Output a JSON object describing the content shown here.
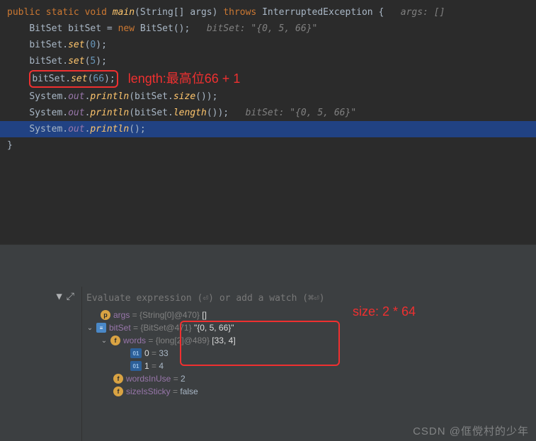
{
  "code": {
    "l1": {
      "public": "public",
      "static": "static",
      "void": "void",
      "main": "main",
      "string": "String",
      "args": "args",
      "throws": "throws",
      "exc": "InterruptedException",
      "comment": "args: []"
    },
    "l2": {
      "type": "BitSet",
      "var": "bitSet",
      "new": "new",
      "ctor": "BitSet",
      "comment": "bitSet: \"{0, 5, 66}\""
    },
    "l3": {
      "obj": "bitSet",
      "method": "set",
      "arg": "0"
    },
    "l4": {
      "obj": "bitSet",
      "method": "set",
      "arg": "5"
    },
    "l5": {
      "obj": "bitSet",
      "method": "set",
      "arg": "66",
      "anno": "length:最高位66 + 1"
    },
    "l6": {
      "sys": "System",
      "out": "out",
      "println": "println",
      "arg": "bitSet",
      "method": "size"
    },
    "l7": {
      "sys": "System",
      "out": "out",
      "println": "println",
      "arg": "bitSet",
      "method": "length",
      "comment": "bitSet: \"{0, 5, 66}\""
    },
    "l8": {
      "sys": "System",
      "out": "out",
      "println": "println"
    }
  },
  "debug": {
    "placeholder": "Evaluate expression (⏎) or add a watch (⌘⏎)",
    "size_anno": "size: 2 * 64",
    "rows": {
      "args": {
        "name": "args",
        "eq": " = ",
        "ref": "{String[0]@470} ",
        "val": "[]"
      },
      "bitSet": {
        "name": "bitSet",
        "eq": " = ",
        "ref": "{BitSet@471} ",
        "val": "\"{0, 5, 66}\""
      },
      "words": {
        "name": "words",
        "eq": " = ",
        "ref": "{long[2]@489} ",
        "val": "[33, 4]"
      },
      "idx0": {
        "name": "0",
        "eq": " = ",
        "val": "33"
      },
      "idx1": {
        "name": "1",
        "eq": " = ",
        "val": "4"
      },
      "wordsInUse": {
        "name": "wordsInUse",
        "eq": " = ",
        "val": "2"
      },
      "sizeIsSticky": {
        "name": "sizeIsSticky",
        "eq": " = ",
        "val": "false"
      }
    }
  },
  "watermark": "CSDN @㑌傥村的少年"
}
